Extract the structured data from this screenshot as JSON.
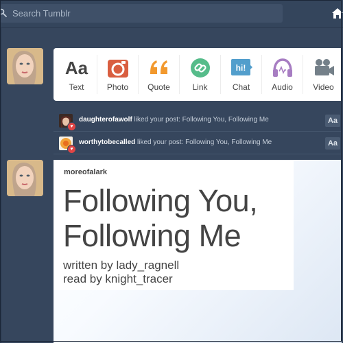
{
  "search": {
    "placeholder": "Search Tumblr"
  },
  "post_types": [
    {
      "label": "Text",
      "icon": "text-icon",
      "color": "#444444"
    },
    {
      "label": "Photo",
      "icon": "camera-icon",
      "color": "#d95e40"
    },
    {
      "label": "Quote",
      "icon": "quote-icon",
      "color": "#f2992e"
    },
    {
      "label": "Link",
      "icon": "link-icon",
      "color": "#56bc8a"
    },
    {
      "label": "Chat",
      "icon": "chat-icon",
      "color": "#529ecc"
    },
    {
      "label": "Audio",
      "icon": "headphones-icon",
      "color": "#a77dc2"
    },
    {
      "label": "Video",
      "icon": "video-camera-icon",
      "color": "#748089"
    }
  ],
  "activity": [
    {
      "user": "daughterofawolf",
      "action": " liked your post: Following You, Following Me",
      "badge": "Aa"
    },
    {
      "user": "worthytobecalled",
      "action": " liked your post: Following You, Following Me",
      "badge": "Aa"
    }
  ],
  "post": {
    "username": "moreofalark",
    "title_line1": "Following You,",
    "title_line2": "Following Me",
    "line1": "written by lady_ragnell",
    "line2": "read by knight_tracer"
  },
  "text_glyph": "Aa",
  "chat_glyph": "hi!"
}
